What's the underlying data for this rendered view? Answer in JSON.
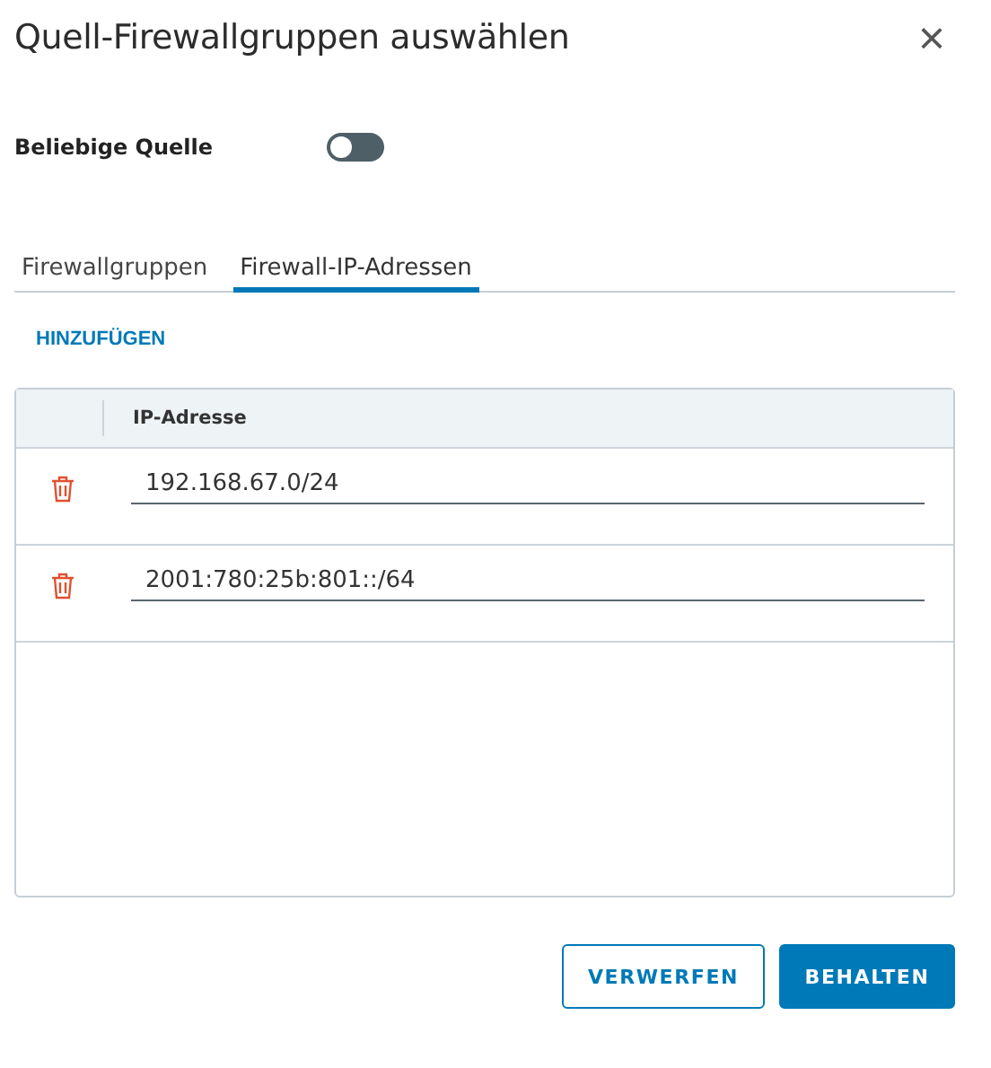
{
  "dialog": {
    "title": "Quell-Firewallgruppen auswählen",
    "close": "×"
  },
  "any_source": {
    "label": "Beliebige Quelle",
    "on": false
  },
  "tabs": [
    {
      "label": "Firewallgruppen",
      "selected": false
    },
    {
      "label": "Firewall-IP-Adressen",
      "selected": true
    }
  ],
  "add_link": "HINZUFÜGEN",
  "table": {
    "columns": [
      "IP-Adresse"
    ],
    "rows": [
      {
        "value": "192.168.67.0/24"
      },
      {
        "value": "2001:780:25b:801::/64"
      }
    ]
  },
  "buttons": [
    {
      "label": "VERWERFEN",
      "kind": "secondary"
    },
    {
      "label": "BEHALTEN",
      "kind": "primary"
    }
  ]
}
